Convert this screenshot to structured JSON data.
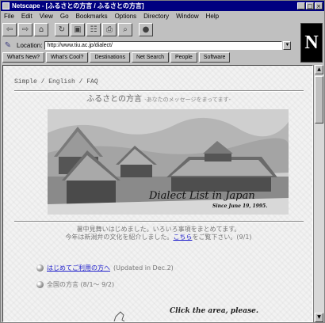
{
  "window": {
    "title": "Netscape - [ふるさとの方言 / ふるさとの方言]"
  },
  "menu": [
    "File",
    "Edit",
    "View",
    "Go",
    "Bookmarks",
    "Options",
    "Directory",
    "Window",
    "Help"
  ],
  "toolbar": {
    "buttons": [
      "back-icon",
      "forward-icon",
      "home-icon",
      "reload-icon",
      "images-icon",
      "open-icon",
      "print-icon",
      "find-icon",
      "stop-icon"
    ]
  },
  "location": {
    "label": "Location:",
    "url": "http://www.tiu.ac.jp/dialect/"
  },
  "directory_buttons": [
    "What's New?",
    "What's Cool?",
    "Destinations",
    "Net Search",
    "People",
    "Software"
  ],
  "page": {
    "breadcrumb": "Simple / English / FAQ",
    "title": "ふるさとの方言",
    "subtitle": "-あなたのメッセージをまってます-",
    "hero_title": "Dialect List in Japan",
    "hero_since": "Since June 19, 1995.",
    "notice_line1": "暑中見舞いはじめました。いろいろ事項をまとめてます。",
    "notice_line2": "今年は新潟弁の文化を紹介しました。",
    "notice_link": "こちら",
    "notice_line2_tail": "をご覧下さい。(9/1)",
    "items": [
      {
        "link": "はじめてご利用の方へ",
        "text": "(Updated in Dec.2)"
      },
      {
        "link": "",
        "text": "全国の方言 (8/1〜 9/2)"
      }
    ],
    "click_hint": "Click the area, please."
  }
}
